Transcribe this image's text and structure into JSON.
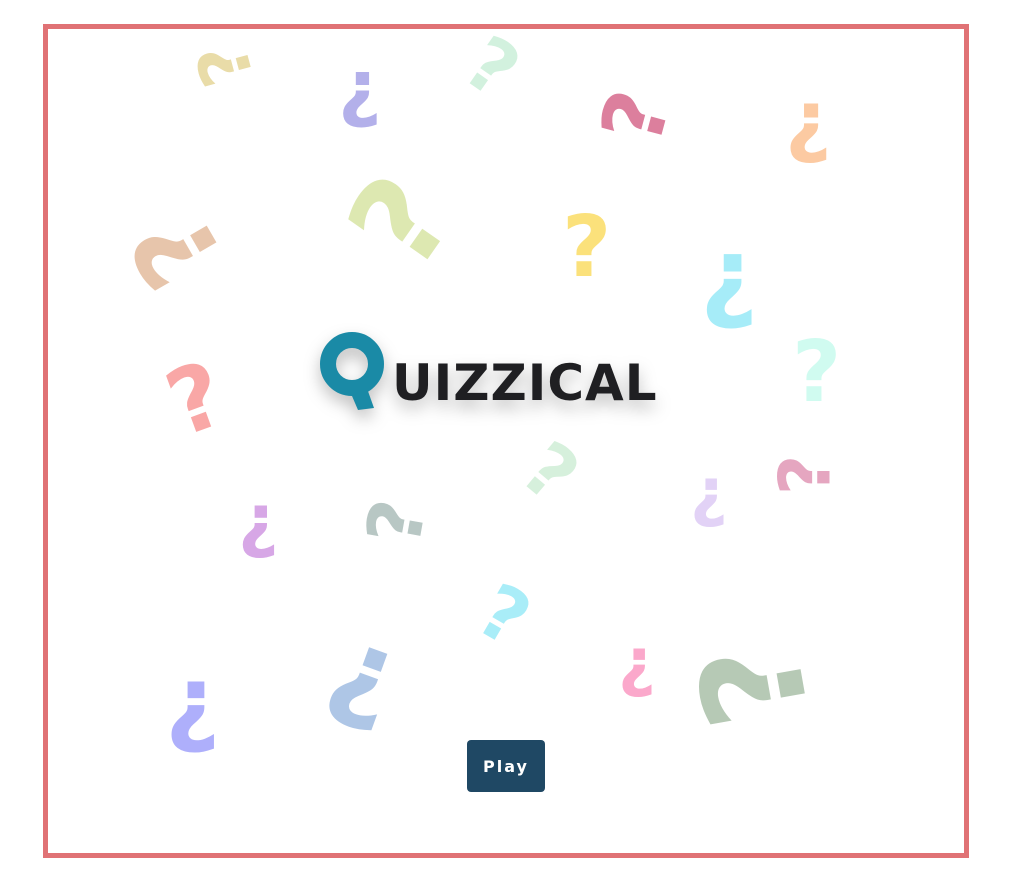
{
  "app": {
    "logo_text": "UIZZICAL",
    "logo_icon": "q-logo-icon",
    "play_label": "Play"
  },
  "colors": {
    "frame_border": "#e07275",
    "play_button": "#1f4864",
    "logo_q": "#1a8aa6"
  },
  "decorations": [
    {
      "glyph": "?",
      "color": "#e9dca8"
    },
    {
      "glyph": "¿",
      "color": "#b3b0ea"
    },
    {
      "glyph": "?",
      "color": "#d2f1de"
    },
    {
      "glyph": "?",
      "color": "#dc7f9d"
    },
    {
      "glyph": "¿",
      "color": "#fccaa2"
    },
    {
      "glyph": "?",
      "color": "#e7c5ab"
    },
    {
      "glyph": "?",
      "color": "#dde8b1"
    },
    {
      "glyph": "?",
      "color": "#fbe17b"
    },
    {
      "glyph": "¿",
      "color": "#a6ecf8"
    },
    {
      "glyph": "?",
      "color": "#f9a7a6"
    },
    {
      "glyph": "?",
      "color": "#d0fbf0"
    },
    {
      "glyph": "?",
      "color": "#d6f0dc"
    },
    {
      "glyph": "¿",
      "color": "#e2d2f6"
    },
    {
      "glyph": "?",
      "color": "#e5a6c0"
    },
    {
      "glyph": "¿",
      "color": "#d7a7e6"
    },
    {
      "glyph": "?",
      "color": "#b8c7c4"
    },
    {
      "glyph": "?",
      "color": "#a9edf8"
    },
    {
      "glyph": "¿",
      "color": "#aeaffb"
    },
    {
      "glyph": "?",
      "color": "#aec6e6"
    },
    {
      "glyph": "¿",
      "color": "#fba8cb"
    },
    {
      "glyph": "?",
      "color": "#b6c9b5"
    }
  ]
}
